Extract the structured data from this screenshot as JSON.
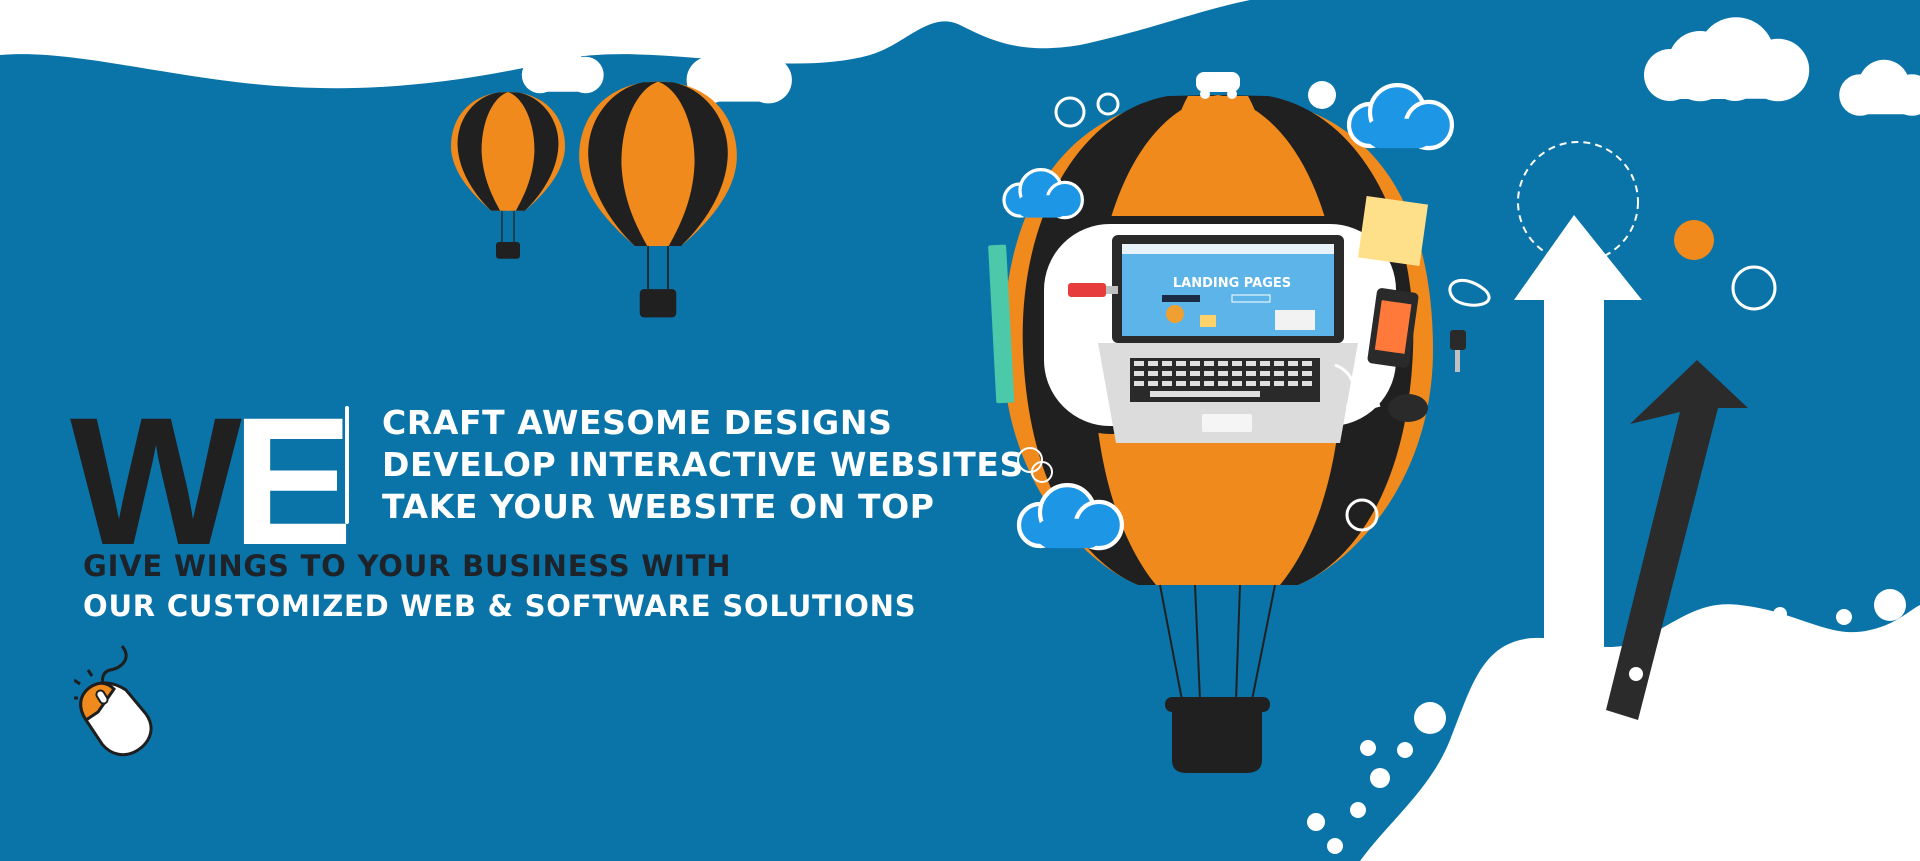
{
  "brand": {
    "background": "#0a74a8",
    "accent": "#f08a1c",
    "dark": "#202020",
    "white": "#ffffff"
  },
  "hero": {
    "we_first": "W",
    "we_second": "E",
    "taglines": [
      "CRAFT AWESOME DESIGNS",
      "DEVELOP INTERACTIVE WEBSITES",
      "TAKE YOUR WEBSITE ON TOP"
    ],
    "subline_1": "GIVE WINGS TO YOUR BUSINESS WITH",
    "subline_2": "OUR CUSTOMIZED WEB & SOFTWARE SOLUTIONS"
  },
  "laptop": {
    "screen_title": "LANDING PAGES"
  },
  "icons": {
    "mouse": "computer-mouse-icon",
    "balloon": "hot-air-balloon-icon",
    "arrow": "up-arrow-icon",
    "cloud": "cloud-icon"
  }
}
